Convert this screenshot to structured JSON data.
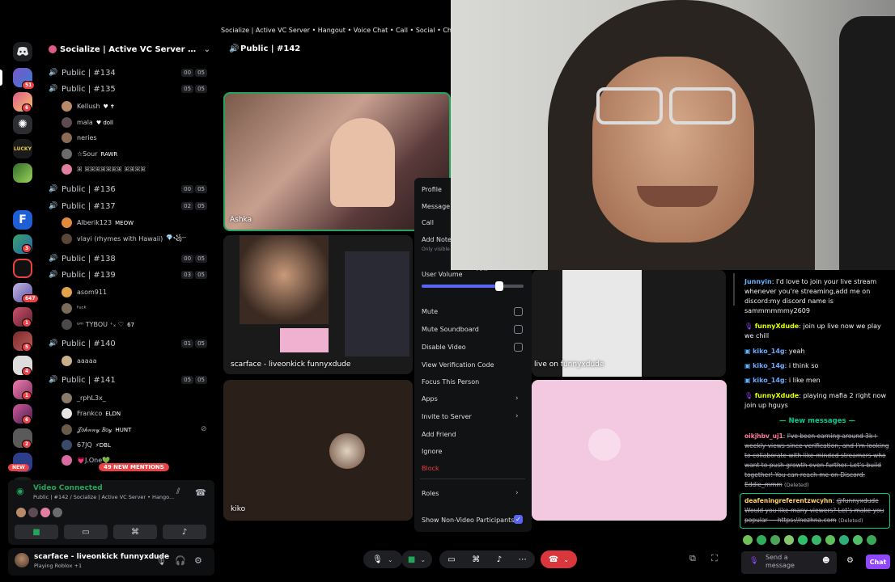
{
  "window": {
    "title": "Socialize | Active VC Server • Hangout • Voice Chat • Call • Social • Chill • A"
  },
  "rail": {
    "badges": [
      "51",
      "6",
      "647",
      "1",
      "5",
      "4",
      "1",
      "6",
      "2"
    ],
    "new_label": "NEW"
  },
  "server": {
    "name": "Socialize | Active VC Server • Hangout ..."
  },
  "channels": [
    {
      "name": "Public | #134",
      "c1": "00",
      "c2": "05"
    },
    {
      "name": "Public | #135",
      "c1": "05",
      "c2": "05"
    },
    {
      "name": "Public | #136",
      "c1": "00",
      "c2": "05"
    },
    {
      "name": "Public | #137",
      "c1": "02",
      "c2": "05"
    },
    {
      "name": "Public | #138",
      "c1": "00",
      "c2": "05"
    },
    {
      "name": "Public | #139",
      "c1": "03",
      "c2": "05"
    },
    {
      "name": "Public | #140",
      "c1": "01",
      "c2": "05"
    },
    {
      "name": "Public | #141",
      "c1": "05",
      "c2": "05"
    }
  ],
  "users": [
    {
      "name": "Kellush",
      "tag": "♥ ✝"
    },
    {
      "name": "mala",
      "tag": "♥ doll"
    },
    {
      "name": "neries",
      "tag": ""
    },
    {
      "name": "☆Sour",
      "tag": "RAWR"
    },
    {
      "name": "ꕤ ꕤꕤꕤꕤꕤꕤꕤ ꕤꕤꕤꕤ",
      "tag": ""
    },
    {
      "name": "Alberik123",
      "tag": "MEOW"
    },
    {
      "name": "vlayi (rhymes with Hawaii)",
      "tag": "💎꧁--"
    },
    {
      "name": "asom911",
      "tag": ""
    },
    {
      "name": "ᶠᵘᶜᵏ",
      "tag": ""
    },
    {
      "name": "ᵘᵐ TYBOU ⁺ₓ ♡",
      "tag": "67"
    },
    {
      "name": "aaaaa",
      "tag": ""
    },
    {
      "name": "_rphL3x_",
      "tag": ""
    },
    {
      "name": "Frankco",
      "tag": "ELDN"
    },
    {
      "name": "𝒥𝑜𝒽𝓃𝓃𝓎 𝐵𝑜𝓎",
      "tag": "HUNT"
    },
    {
      "name": "67JQ",
      "tag": "⚡DBL"
    },
    {
      "name": "💗J.One💚",
      "tag": ""
    }
  ],
  "mentions": "49 NEW MENTIONS",
  "voice": {
    "status": "Video Connected",
    "channel": "Public | #142 / Socialize | Active VC Server • Hango..."
  },
  "me": {
    "name": "scarface - liveonkick funnyxdude",
    "status": "Playing Roblox +1"
  },
  "call": {
    "title": "Public | #142",
    "tiles": {
      "ashka": "Ashka",
      "scarface": "scarface - liveonkick funnyxdude",
      "live": "live on funnyxdude",
      "kiko": "kiko"
    }
  },
  "context_menu": {
    "profile": "Profile",
    "message": "Message",
    "call": "Call",
    "add_note": "Add Note",
    "note_hint": "Only visible",
    "volume_value": "76%",
    "user_volume": "User Volume",
    "volume_level": 0.76,
    "mute": "Mute",
    "mute_soundboard": "Mute Soundboard",
    "disable_video": "Disable Video",
    "verification": "View Verification Code",
    "focus": "Focus This Person",
    "apps": "Apps",
    "invite": "Invite to Server",
    "add_friend": "Add Friend",
    "ignore": "Ignore",
    "block": "Block",
    "roles": "Roles",
    "show_non_video": "Show Non-Video Participants"
  },
  "chat": {
    "messages": [
      {
        "user": "Junnyin",
        "text": "I'd love to join your live stream whenever you're streaming,add me on discord:my discord name is sammmmmmy2609",
        "color": "#5fb3ff"
      },
      {
        "user": "funnyXdude",
        "text": "join up live now we play we chill",
        "color": "#e5ff00"
      },
      {
        "user": "kiko_14g",
        "text": "yeah",
        "color": "#6aa9ff"
      },
      {
        "user": "kiko_14g",
        "text": "i think so",
        "color": "#6aa9ff"
      },
      {
        "user": "kiko_14g",
        "text": "i like men",
        "color": "#6aa9ff"
      },
      {
        "user": "funnyXdude",
        "text": "playing mafia 2 right now join up hguys",
        "color": "#e5ff00"
      }
    ],
    "new_messages": "New messages",
    "deleted": [
      {
        "user": "oikjhbv_uj1",
        "text": "I've been earning around 3k+ weekly views since verification, and I'm looking to collaborate with like-minded streamers who want to push growth even further. Let's build together! You can reach me on Discord: Eddie_mmm",
        "flag": "(Deleted)"
      },
      {
        "user": "deafeningreferentzwcyhn",
        "text": "@funnyxdude Would you like many viewers? Let's make you popular — https://nezhna.com",
        "flag": "(Deleted)"
      }
    ],
    "input_placeholder": "Send a message",
    "send_label": "Chat"
  },
  "colors": {
    "accent": "#5865f2",
    "danger": "#ed4245",
    "connected": "#23a55a",
    "twitch": "#9147ff"
  }
}
